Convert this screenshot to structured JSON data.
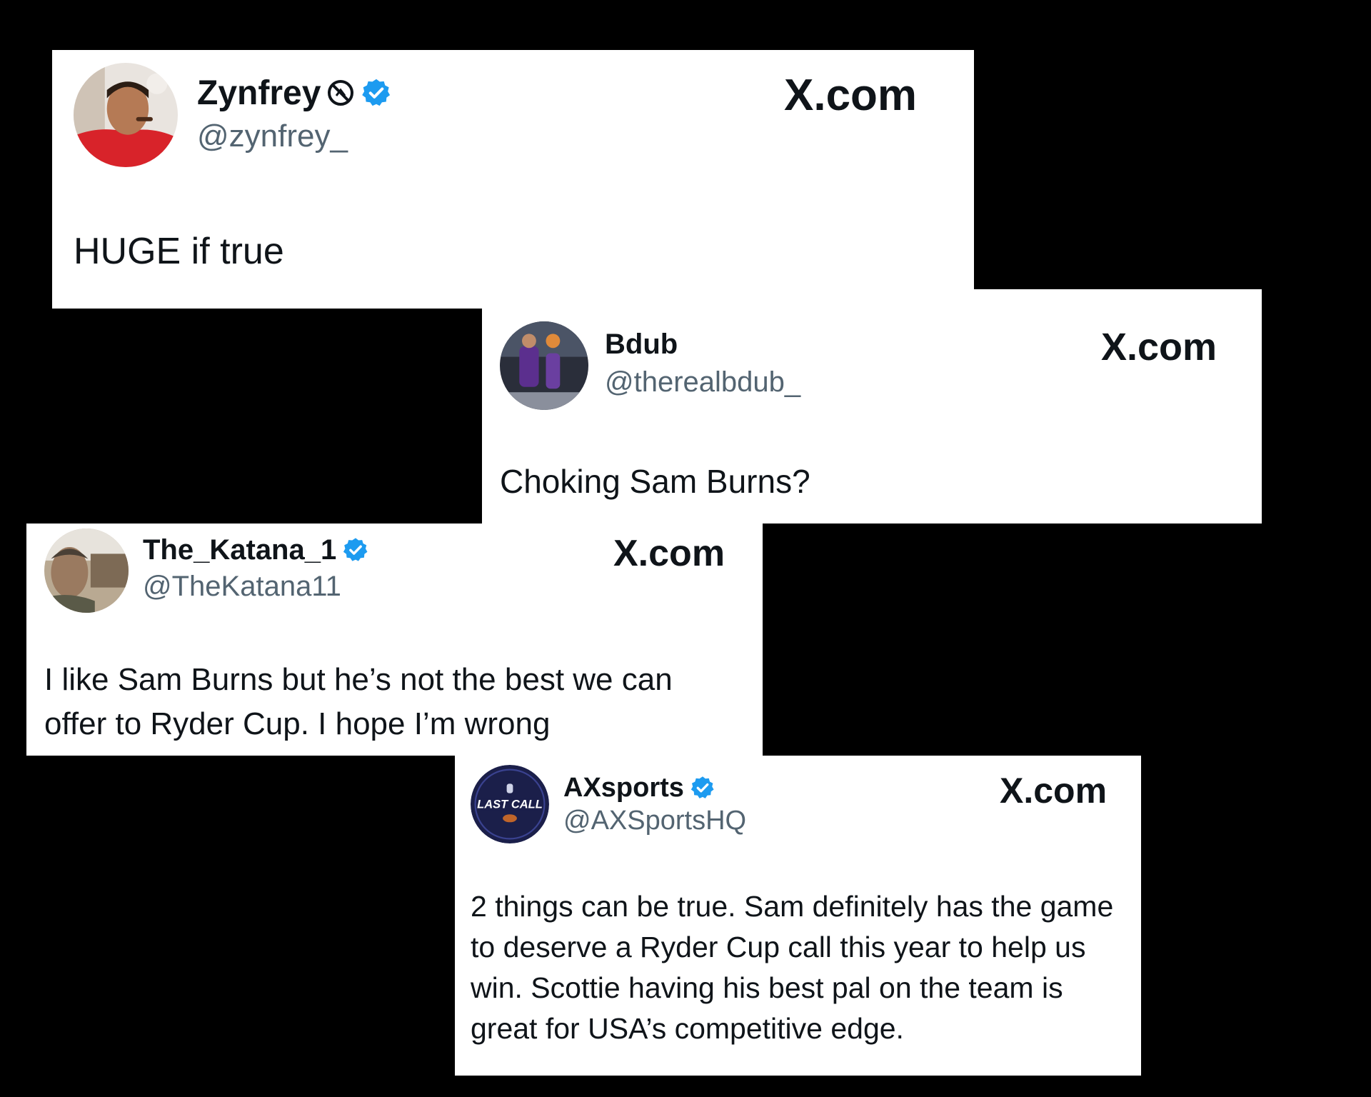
{
  "colors": {
    "background": "#000000",
    "card": "#ffffff",
    "name": "#0f1419",
    "handle": "#536471",
    "verified": "#1d9bf0"
  },
  "posts": [
    {
      "display_name": "Zynfrey",
      "handle": "@zynfrey_",
      "verified": true,
      "affiliate_badge_icon": "restricted-circle-icon",
      "site": "X.com",
      "text": "HUGE if true",
      "avatar_icon": "man-red-shirt-avatar"
    },
    {
      "display_name": "Bdub",
      "handle": "@therealbdub_",
      "verified": false,
      "site": "X.com",
      "text": "Choking Sam Burns?",
      "avatar_icon": "basketball-player-avatar"
    },
    {
      "display_name": "The_Katana_1",
      "handle": "@TheKatana11",
      "verified": true,
      "site": "X.com",
      "text_lines": [
        "I like Sam Burns but he’s not the best we can",
        "offer to Ryder Cup. I hope I’m wrong"
      ],
      "avatar_icon": "man-outdoors-avatar"
    },
    {
      "display_name": "AXsports",
      "handle": "@AXSportsHQ",
      "verified": true,
      "site": "X.com",
      "text_lines": [
        "2 things can be true. Sam definitely has the game",
        "to deserve a Ryder Cup call this year to help us",
        "win. Scottie having his best pal on the team is",
        "great for USA’s competitive edge."
      ],
      "avatar_icon": "last-call-logo-avatar",
      "avatar_logo_text": "LAST CALL"
    }
  ]
}
